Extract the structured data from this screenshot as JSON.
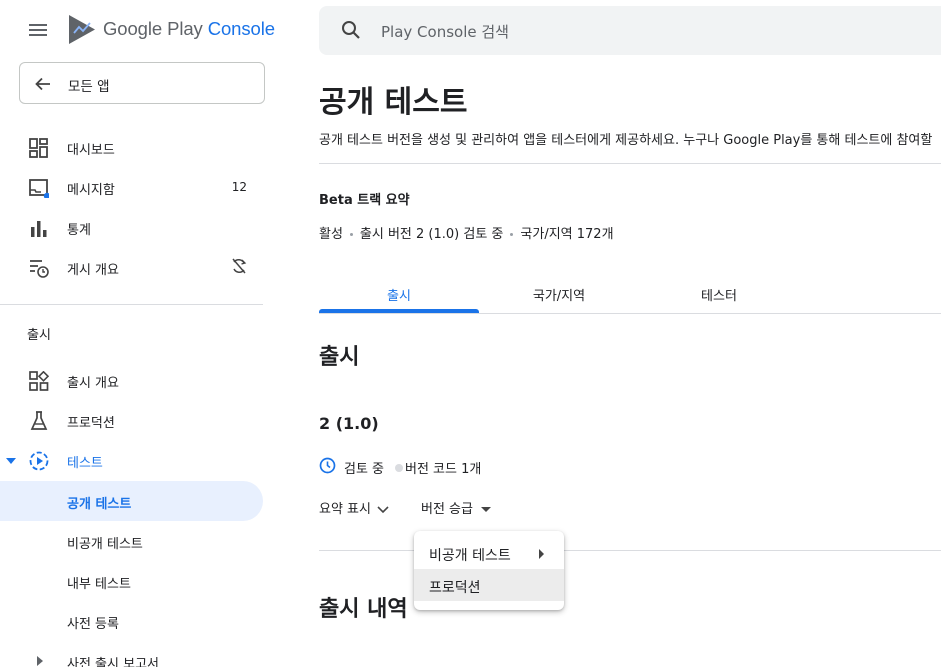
{
  "header": {
    "brand_part1": "Google Play",
    "brand_part2": " Console",
    "all_apps_label": "모든 앱",
    "search_placeholder": "Play Console 검색"
  },
  "sidebar": {
    "items": [
      {
        "label": "대시보드",
        "icon": "dashboard-icon"
      },
      {
        "label": "메시지함",
        "icon": "inbox-icon",
        "count": "12"
      },
      {
        "label": "통계",
        "icon": "bar-chart-icon"
      },
      {
        "label": "게시 개요",
        "icon": "publishing-icon",
        "trail_icon": "sync-disabled-icon"
      }
    ],
    "section_title": "출시",
    "release_items": [
      {
        "label": "출시 개요",
        "icon": "release-overview-icon"
      },
      {
        "label": "프로덕션",
        "icon": "flask-icon"
      },
      {
        "label": "테스트",
        "icon": "testing-icon",
        "expanded": true
      }
    ],
    "testing_subitems": [
      {
        "label": "공개 테스트",
        "selected": true
      },
      {
        "label": "비공개 테스트"
      },
      {
        "label": "내부 테스트"
      },
      {
        "label": "사전 등록"
      },
      {
        "label": "사전 출시 보고서",
        "collapsible": true
      }
    ]
  },
  "main": {
    "title": "공개 테스트",
    "description": "공개 테스트 버전을 생성 및 관리하여 앱을 테스터에게 제공하세요. 누구나 Google Play를 통해 테스트에 참여할",
    "track_summary_title": "Beta 트랙 요약",
    "track_status": [
      "활성",
      "출시 버전 2 (1.0) 검토 중",
      "국가/지역 172개"
    ],
    "tabs": [
      {
        "label": "출시",
        "active": true
      },
      {
        "label": "국가/지역"
      },
      {
        "label": "테스터"
      }
    ],
    "release_heading": "출시",
    "version": "2 (1.0)",
    "version_status": "검토 중",
    "version_codes": "버전 코드 1개",
    "summary_button": "요약 표시",
    "promote_button": "버전 승급",
    "history_heading": "출시 내역"
  },
  "promote_menu": {
    "items": [
      {
        "label": "비공개 테스트",
        "has_submenu": true
      },
      {
        "label": "프로덕션",
        "hovered": true
      }
    ]
  },
  "colors": {
    "accent": "#1a73e8",
    "selected_bg": "#e8f0fe",
    "text": "#202124",
    "muted": "#5f6368"
  }
}
